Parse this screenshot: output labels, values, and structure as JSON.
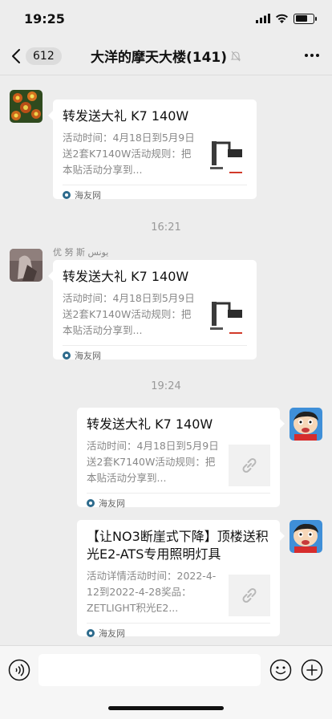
{
  "status_bar": {
    "time": "19:25"
  },
  "nav": {
    "unread_count": "612",
    "title": "大洋的摩天大楼(141)"
  },
  "messages": [
    {
      "title": "转发送大礼 K7 140W",
      "desc": "活动时间：4月18日到5月9日送2套K7140W活动规则：把本贴活动分享到...",
      "source": "海友网"
    },
    {
      "sender": "优 努 斯  يونس",
      "title": "转发送大礼 K7 140W",
      "desc": "活动时间：4月18日到5月9日送2套K7140W活动规则：把本贴活动分享到...",
      "source": "海友网"
    },
    {
      "title": "转发送大礼 K7 140W",
      "desc": "活动时间：4月18日到5月9日送2套K7140W活动规则：把本贴活动分享到...",
      "source": "海友网"
    },
    {
      "title": "【让NO3断崖式下降】顶楼送积光E2-ATS专用照明灯具",
      "desc": "活动详情活动时间：2022-4-12到2022-4-28奖品：ZETLIGHT积光E2...",
      "source": "海友网"
    }
  ],
  "timestamps": [
    "16:21",
    "19:24"
  ],
  "input": {
    "placeholder": ""
  },
  "colors": {
    "background": "#ededed",
    "card": "#ffffff",
    "meta": "#888888"
  }
}
